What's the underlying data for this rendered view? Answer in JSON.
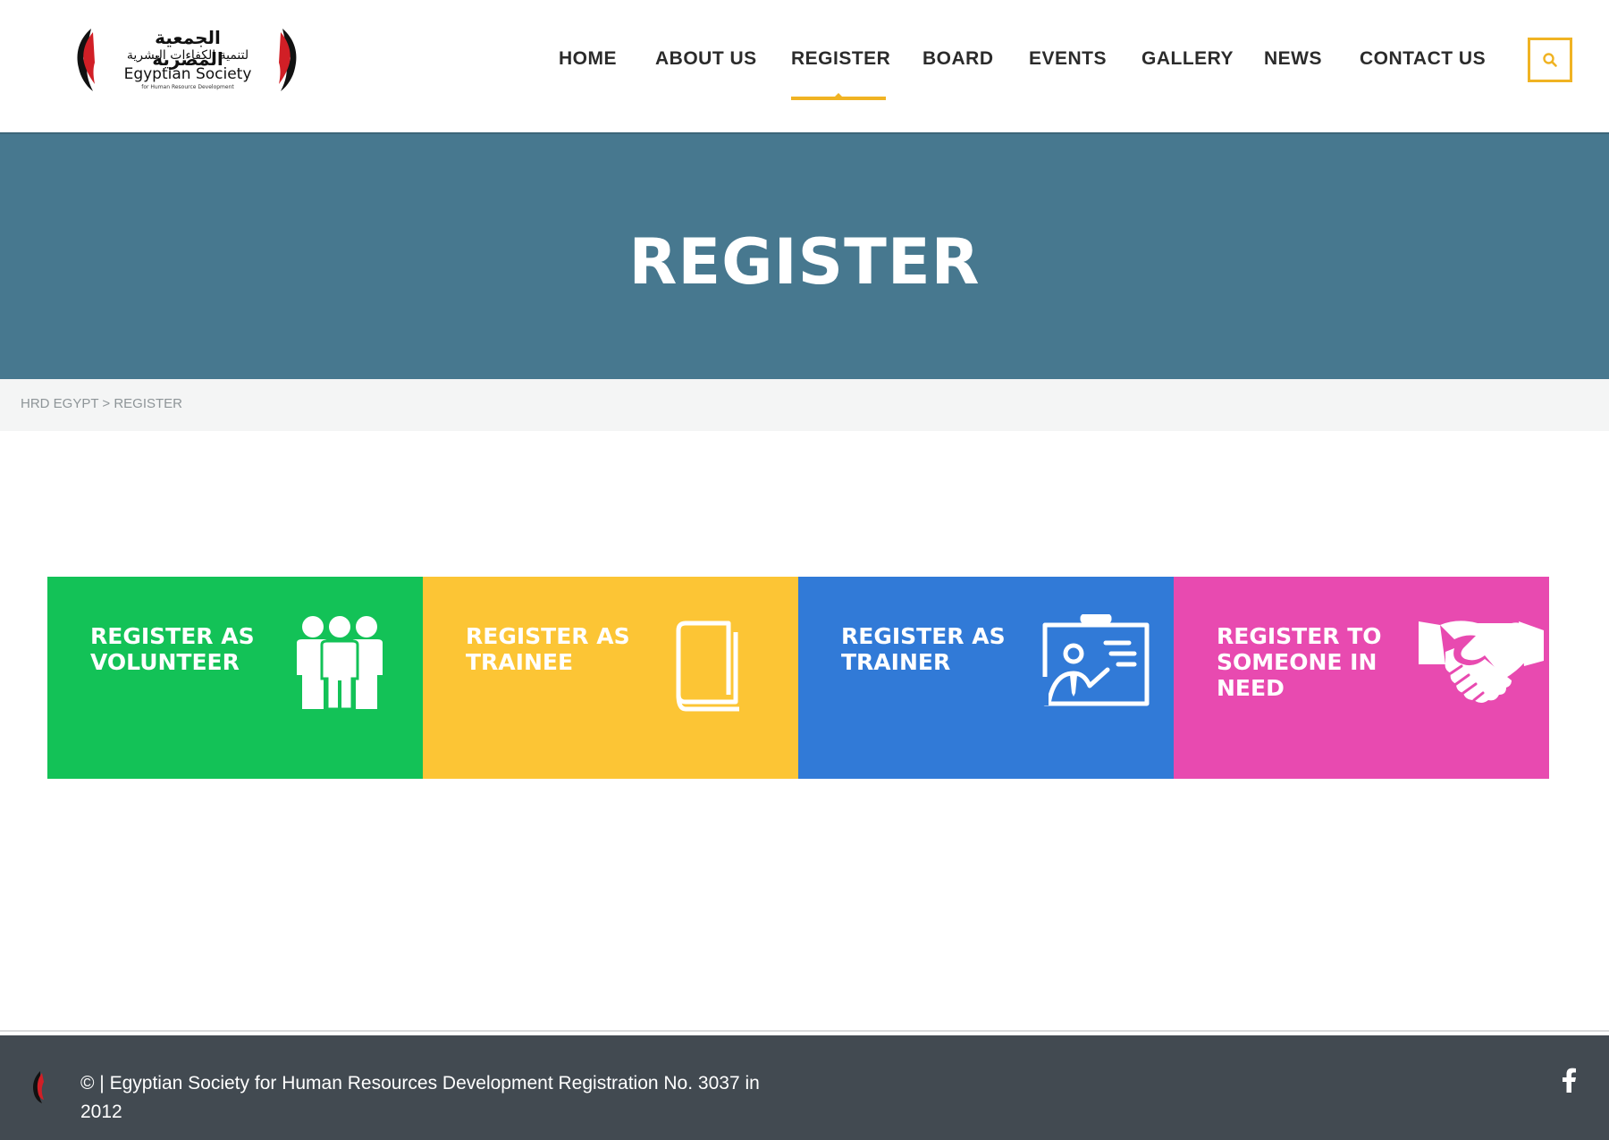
{
  "logo": {
    "arabic_line1": "الجمعية المصرية",
    "arabic_line2": "لتنمية الكفاءات البشرية",
    "english_name": "Egyptian Society",
    "english_sub": "for Human Resource Development"
  },
  "nav": {
    "items": [
      {
        "label": "HOME"
      },
      {
        "label": "ABOUT US"
      },
      {
        "label": "REGISTER",
        "active": true
      },
      {
        "label": "BOARD"
      },
      {
        "label": "EVENTS"
      },
      {
        "label": "GALLERY"
      },
      {
        "label": "NEWS"
      },
      {
        "label": "CONTACT US"
      }
    ],
    "search_icon": "search-icon"
  },
  "hero": {
    "title": "REGISTER"
  },
  "breadcrumb": {
    "text": "HRD EGYPT > REGISTER"
  },
  "cards": [
    {
      "label": "REGISTER AS VOLUNTEER",
      "color": "#13c257",
      "icon": "people-icon"
    },
    {
      "label": "REGISTER AS TRAINEE",
      "color": "#fcc535",
      "icon": "book-icon"
    },
    {
      "label": "REGISTER AS TRAINER",
      "color": "#317ad7",
      "icon": "presentation-board-icon"
    },
    {
      "label": "REGISTER TO SOMEONE IN NEED",
      "color": "#e84ab0",
      "icon": "handshake-icon"
    }
  ],
  "footer": {
    "copyright": "© | Egyptian Society for Human Resources Development Registration No. 3037 in 2012",
    "social_icon": "facebook-icon"
  },
  "colors": {
    "accent": "#f0b323",
    "hero_bg": "#47788f",
    "footer_bg": "#424a51",
    "breadcrumb_bg": "#f4f5f5"
  }
}
